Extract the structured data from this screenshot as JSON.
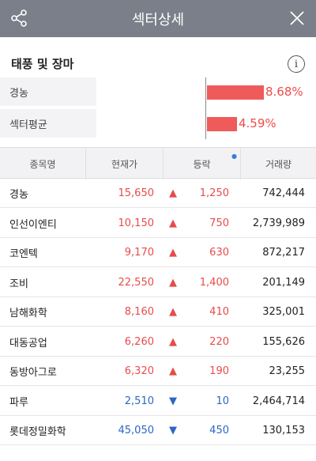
{
  "header": {
    "title": "섹터상세"
  },
  "section": {
    "title": "태풍 및 장마"
  },
  "comparison": [
    {
      "label": "경농",
      "pct_text": "8.68%",
      "value": 8.68
    },
    {
      "label": "섹터평균",
      "pct_text": "4.59%",
      "value": 4.59
    }
  ],
  "table": {
    "headers": [
      "종목명",
      "현재가",
      "등락",
      "거래량"
    ],
    "rows": [
      {
        "name": "경농",
        "price": "15,650",
        "dir": "up",
        "change": "1,250",
        "volume": "742,444"
      },
      {
        "name": "인선이엔티",
        "price": "10,150",
        "dir": "up",
        "change": "750",
        "volume": "2,739,989"
      },
      {
        "name": "코엔텍",
        "price": "9,170",
        "dir": "up",
        "change": "630",
        "volume": "872,217"
      },
      {
        "name": "조비",
        "price": "22,550",
        "dir": "up",
        "change": "1,400",
        "volume": "201,149"
      },
      {
        "name": "남해화학",
        "price": "8,160",
        "dir": "up",
        "change": "410",
        "volume": "325,001"
      },
      {
        "name": "대동공업",
        "price": "6,260",
        "dir": "up",
        "change": "220",
        "volume": "155,626"
      },
      {
        "name": "동방아그로",
        "price": "6,320",
        "dir": "up",
        "change": "190",
        "volume": "23,255"
      },
      {
        "name": "파루",
        "price": "2,510",
        "dir": "down",
        "change": "10",
        "volume": "2,464,714"
      },
      {
        "name": "롯데정밀화학",
        "price": "45,050",
        "dir": "down",
        "change": "450",
        "volume": "130,153"
      }
    ]
  },
  "colors": {
    "up": "#e84b4b",
    "down": "#2b66c4",
    "bar": "#ef5a5a",
    "header_bg": "#7b7f89"
  }
}
